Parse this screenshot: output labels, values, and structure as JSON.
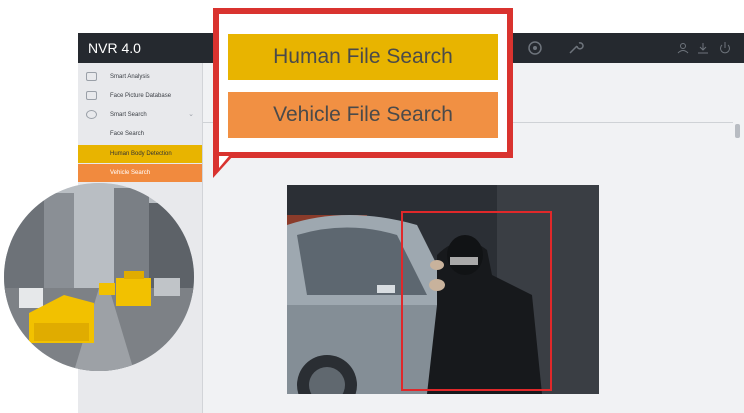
{
  "app": {
    "title": "NVR 4.0"
  },
  "toolbar_icons": [
    "gear-icon",
    "wrench-icon",
    "user-icon",
    "download-icon",
    "power-icon"
  ],
  "sidebar": {
    "items": [
      {
        "label": "Smart Analysis",
        "icon": "chart-icon"
      },
      {
        "label": "Face Picture Database",
        "icon": "face-db-icon"
      },
      {
        "label": "Smart Search",
        "icon": "search-icon"
      },
      {
        "label": "Face Search"
      },
      {
        "label": "Human Body Detection"
      },
      {
        "label": "Vehicle Search"
      }
    ]
  },
  "callout": {
    "human_label": "Human File Search",
    "vehicle_label": "Vehicle File Search"
  },
  "colors": {
    "highlight_yellow": "#e8b400",
    "highlight_orange": "#f18a3e",
    "callout_border": "#d9332f",
    "bbox": "#e0282a"
  }
}
